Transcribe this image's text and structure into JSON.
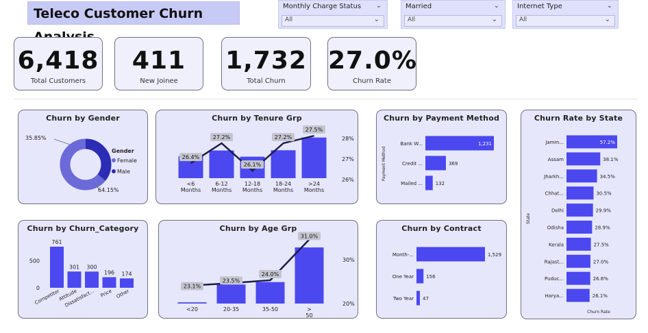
{
  "title": "Teleco Customer Churn Analysis",
  "slicers": [
    {
      "label": "Monthly Charge Status",
      "value": "All"
    },
    {
      "label": "Married",
      "value": "All"
    },
    {
      "label": "Internet Type",
      "value": "All"
    }
  ],
  "kpis": [
    {
      "value": "6,418",
      "caption": "Total Customers"
    },
    {
      "value": "411",
      "caption": "New Joinee"
    },
    {
      "value": "1,732",
      "caption": "Total Churn"
    },
    {
      "value": "27.0%",
      "caption": "Churn Rate"
    }
  ],
  "colors": {
    "bar": "#4b48f0",
    "line": "#1c1d4a",
    "female": "#6b6ad8",
    "male": "#2c2db4",
    "card": "#e6e7fb",
    "title_bg": "#c8caf6"
  },
  "chart_data": [
    {
      "id": "gender",
      "type": "pie",
      "title": "Churn by Gender",
      "legend_title": "Gender",
      "legend_position": "right",
      "slices": [
        {
          "name": "Female",
          "value": 64.15,
          "label": "64.15%"
        },
        {
          "name": "Male",
          "value": 35.85,
          "label": "35.85%"
        }
      ]
    },
    {
      "id": "tenure",
      "type": "bar",
      "title": "Churn by Tenure Grp",
      "categories": [
        "<6 Months",
        "6-12 Months",
        "12-18 Months",
        "18-24 Months",
        ">24 Months"
      ],
      "values": [
        180,
        228,
        177,
        230,
        335
      ],
      "line": {
        "values": [
          26.4,
          27.2,
          26.1,
          27.2,
          27.5
        ],
        "labels": [
          "26.4%",
          "27.2%",
          "26.1%",
          "27.2%",
          "27.5%"
        ]
      },
      "y2_ticks": [
        "28%",
        "27%",
        "26%"
      ],
      "y2lim": [
        25.8,
        28
      ]
    },
    {
      "id": "payment",
      "type": "bar",
      "orientation": "horizontal",
      "title": "Churn by Payment Method",
      "ylabel": "Payment Method",
      "categories": [
        "Bank W...",
        "Credit ...",
        "Mailed ..."
      ],
      "values": [
        1231,
        369,
        132
      ],
      "labels": [
        "1,231",
        "369",
        "132"
      ]
    },
    {
      "id": "state",
      "type": "bar",
      "orientation": "horizontal",
      "title": "Churn Rate by State",
      "xlabel": "Churn Rate",
      "ylabel": "State",
      "categories": [
        "Jamm...",
        "Assam",
        "Jharkh...",
        "Chhat...",
        "Delhi",
        "Odisha",
        "Kerala",
        "Rajast...",
        "Puduc...",
        "Harya..."
      ],
      "values": [
        57.2,
        38.1,
        34.5,
        30.5,
        29.9,
        28.9,
        27.5,
        27.0,
        26.8,
        26.1
      ],
      "labels": [
        "57.2%",
        "38.1%",
        "34.5%",
        "30.5%",
        "29.9%",
        "28.9%",
        "27.5%",
        "27.0%",
        "26.8%",
        "26.1%"
      ]
    },
    {
      "id": "category",
      "type": "bar",
      "title": "Churn by Churn_Category",
      "categories": [
        "Competitor",
        "Attitude",
        "Dissatisfact...",
        "Price",
        "Other"
      ],
      "values": [
        761,
        301,
        300,
        196,
        174
      ],
      "labels": [
        "761",
        "301",
        "300",
        "196",
        "174"
      ],
      "y_ticks": [
        "500",
        "0"
      ],
      "ylim": [
        0,
        800
      ]
    },
    {
      "id": "age",
      "type": "bar",
      "title": "Churn by Age Grp",
      "categories": [
        "<20",
        "20-35",
        "35-50",
        "> 50"
      ],
      "values": [
        25,
        390,
        440,
        1150
      ],
      "line": {
        "values": [
          23.1,
          23.5,
          24.0,
          31.0
        ],
        "labels": [
          "23.1%",
          "23.5%",
          "24.0%",
          "31.0%"
        ]
      },
      "y2_ticks": [
        "30%",
        "20%"
      ],
      "y2lim": [
        20,
        30
      ]
    },
    {
      "id": "contract",
      "type": "bar",
      "orientation": "horizontal",
      "title": "Churn by Contract",
      "categories": [
        "Month-...",
        "One Year",
        "Two Year"
      ],
      "values": [
        1529,
        156,
        47
      ],
      "labels": [
        "1,529",
        "156",
        "47"
      ]
    }
  ]
}
